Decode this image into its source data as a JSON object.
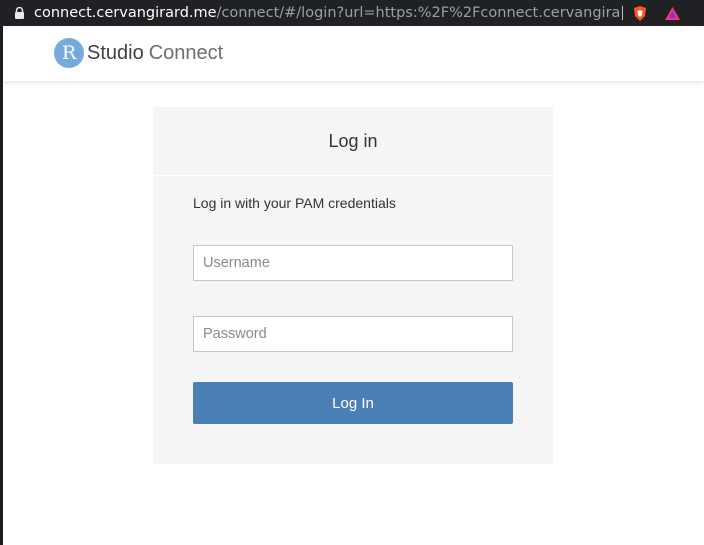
{
  "browser": {
    "url_host": "connect.cervangirard.me",
    "url_path": "/connect/#/login?url=https:%2F%2Fconnect.cervangirard.me...",
    "icons": [
      "lock-icon",
      "brave-shield-icon",
      "brave-rewards-icon"
    ]
  },
  "header": {
    "logo_letter": "R",
    "logo_studio": "Studio",
    "logo_connect": "Connect"
  },
  "login": {
    "title": "Log in",
    "subtitle": "Log in with your PAM credentials",
    "username_placeholder": "Username",
    "password_placeholder": "Password",
    "button_label": "Log In"
  },
  "colors": {
    "accent": "#4a80b5",
    "logo_blue": "#75aadb",
    "panel_bg": "#f5f5f5"
  }
}
